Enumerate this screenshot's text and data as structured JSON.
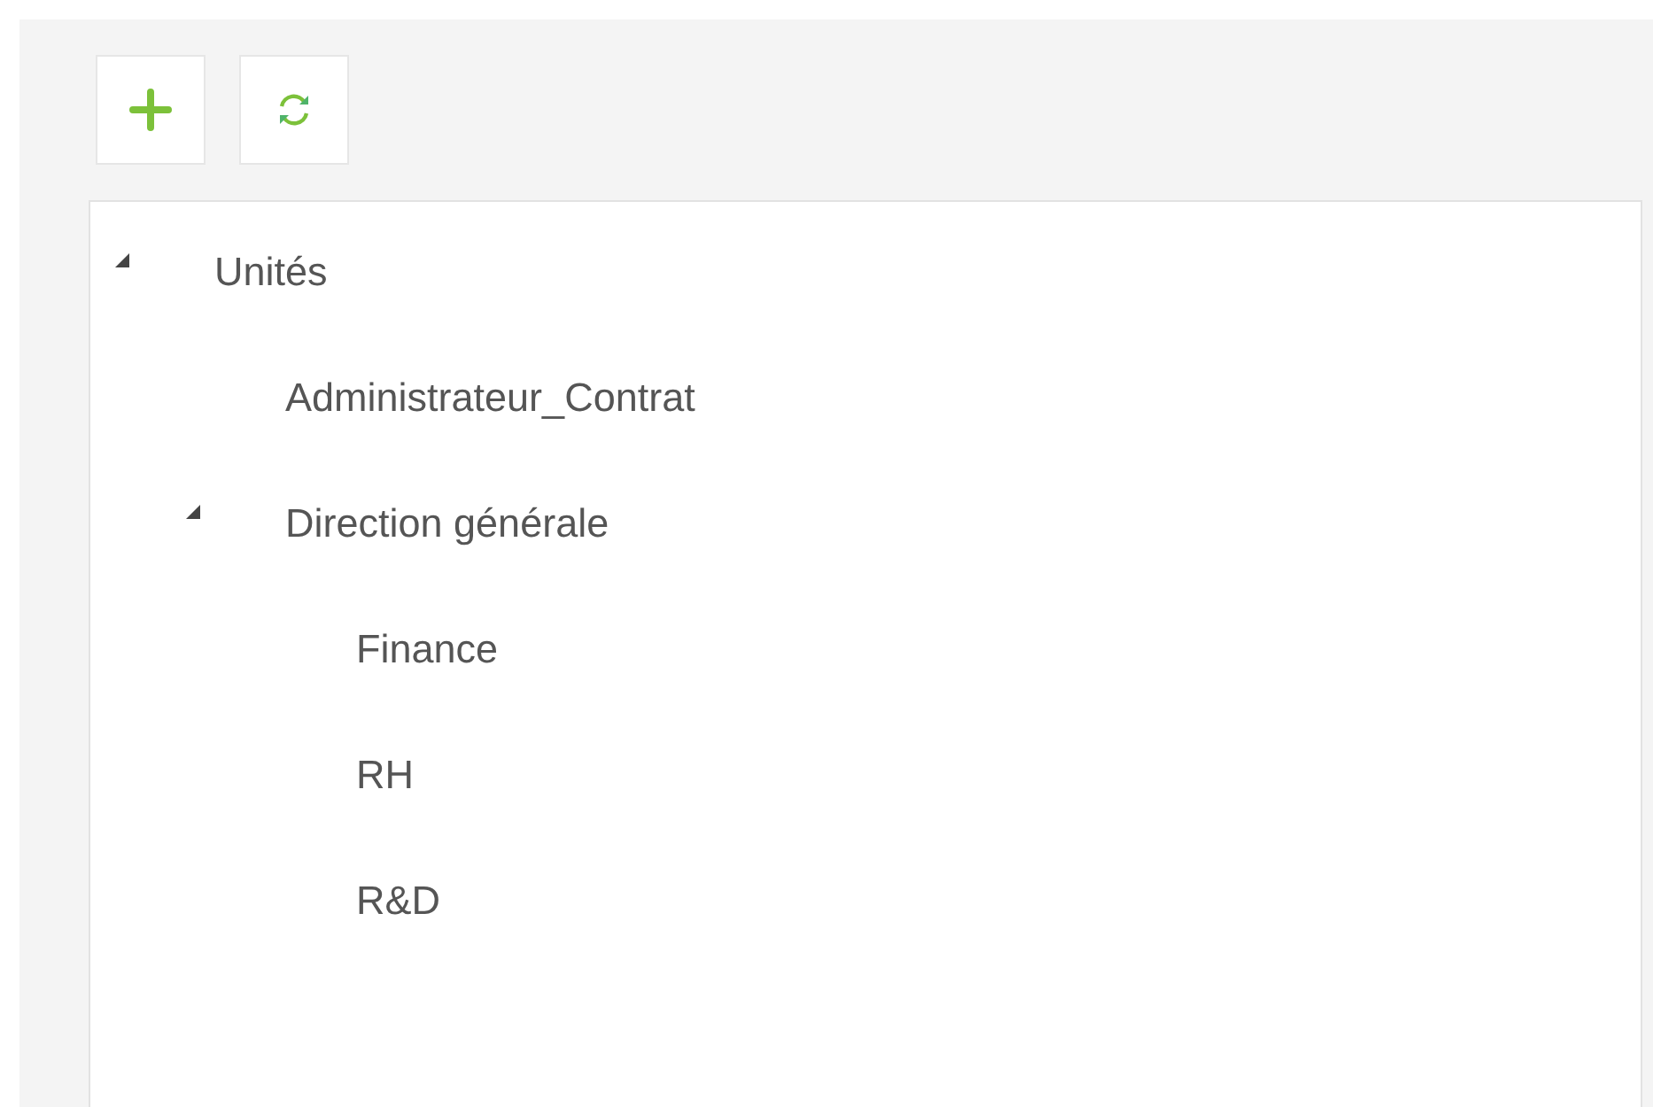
{
  "toolbar": {
    "buttons": [
      {
        "kind": "add"
      },
      {
        "kind": "refresh"
      }
    ]
  },
  "tree": [
    {
      "label": "Unités",
      "expanded": true,
      "children": [
        {
          "label": "Administrateur_Contrat"
        },
        {
          "label": "Direction générale",
          "expanded": true,
          "children": [
            {
              "label": "Finance"
            },
            {
              "label": "RH"
            },
            {
              "label": "R&D"
            }
          ]
        }
      ]
    }
  ]
}
